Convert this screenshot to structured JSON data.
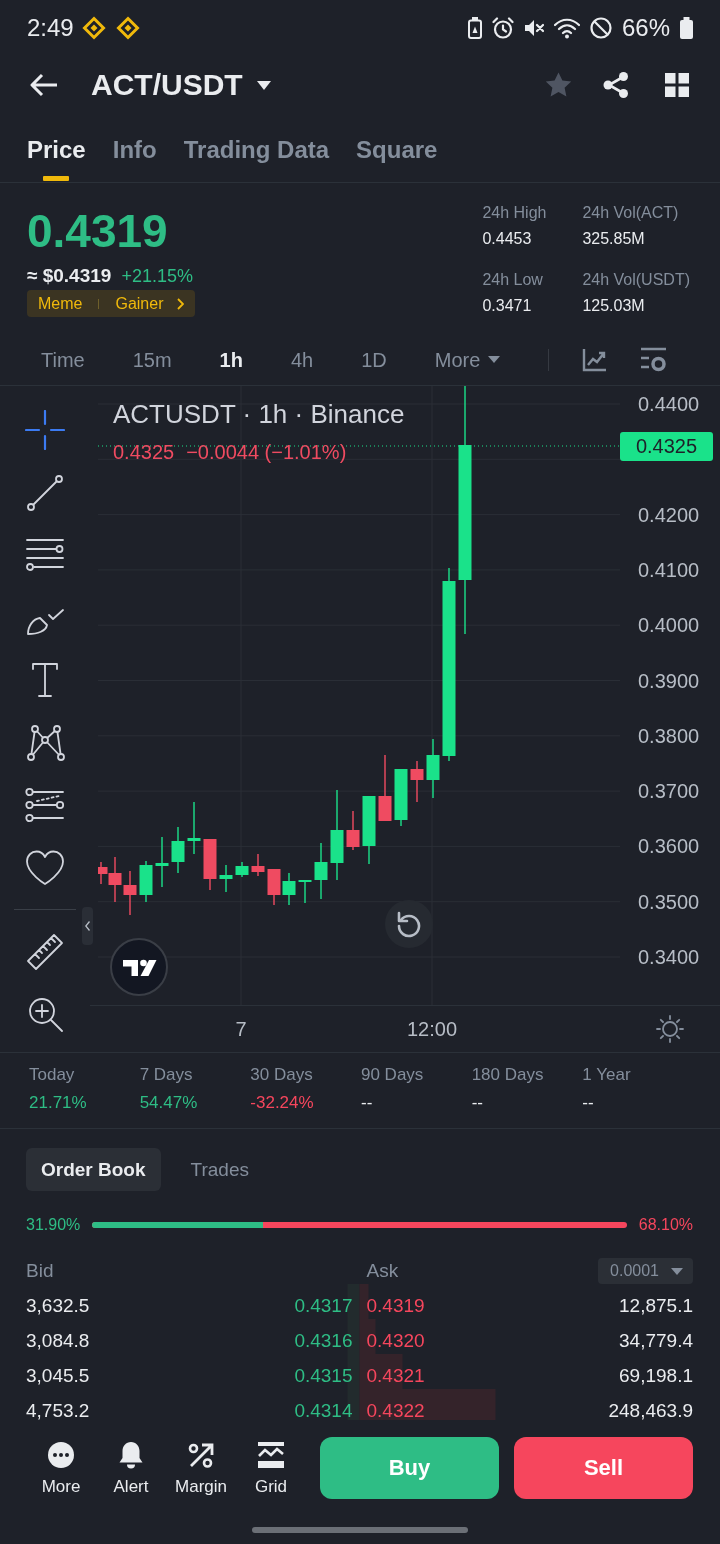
{
  "status_bar": {
    "time": "2:49",
    "battery": "66%"
  },
  "header": {
    "pair": "ACT/USDT",
    "favorited": false
  },
  "tabs": [
    {
      "label": "Price",
      "selected": true
    },
    {
      "label": "Info",
      "selected": false
    },
    {
      "label": "Trading Data",
      "selected": false
    },
    {
      "label": "Square",
      "selected": false
    }
  ],
  "ticker": {
    "price": "0.4319",
    "fiat_price": "≈ $0.4319",
    "change": "+21.15%",
    "tags": [
      "Meme",
      "Gainer"
    ],
    "stats": [
      {
        "label": "24h High",
        "value": "0.4453"
      },
      {
        "label": "24h Vol(ACT)",
        "value": "325.85M"
      },
      {
        "label": "24h Low",
        "value": "0.3471"
      },
      {
        "label": "24h Vol(USDT)",
        "value": "125.03M"
      }
    ]
  },
  "intervals": [
    {
      "label": "Time",
      "selected": false
    },
    {
      "label": "15m",
      "selected": false
    },
    {
      "label": "1h",
      "selected": true
    },
    {
      "label": "4h",
      "selected": false
    },
    {
      "label": "1D",
      "selected": false
    },
    {
      "label": "More",
      "selected": false
    }
  ],
  "drawing_tools": [
    {
      "kind": "crosshair",
      "selected": true
    },
    {
      "kind": "line",
      "selected": false
    },
    {
      "kind": "lines",
      "selected": false
    },
    {
      "kind": "brush",
      "selected": false
    },
    {
      "kind": "text",
      "selected": false
    },
    {
      "kind": "pattern",
      "selected": false
    },
    {
      "kind": "fib",
      "selected": false
    },
    {
      "kind": "heart",
      "selected": false
    }
  ],
  "measure_tools": [
    {
      "kind": "ruler",
      "selected": false
    },
    {
      "kind": "zoom",
      "selected": false
    }
  ],
  "chart": {
    "title": "ACTUSDT · 1h · Binance",
    "close": "0.4325",
    "change": "−0.0044 (−1.01%)",
    "last_price": "0.4325",
    "price_labels": [
      "0.4400",
      "0.4200",
      "0.4100",
      "0.4000",
      "0.3900",
      "0.3800",
      "0.3700",
      "0.3600",
      "0.3500",
      "0.3400"
    ],
    "time_labels": [
      "7",
      "12:00"
    ]
  },
  "periods": [
    {
      "label": "Today",
      "value": "21.71%",
      "color": "#2ebd85"
    },
    {
      "label": "7 Days",
      "value": "54.47%",
      "color": "#2ebd85"
    },
    {
      "label": "30 Days",
      "value": "-32.24%",
      "color": "#f6465d"
    },
    {
      "label": "90 Days",
      "value": "--",
      "color": "#eaecef"
    },
    {
      "label": "180 Days",
      "value": "--",
      "color": "#eaecef"
    },
    {
      "label": "1 Year",
      "value": "--",
      "color": "#eaecef"
    }
  ],
  "order_book": {
    "tabs": [
      {
        "label": "Order Book",
        "selected": true
      },
      {
        "label": "Trades",
        "selected": false
      }
    ],
    "buy_share": "31.90%",
    "sell_share": "68.10%",
    "ratio": {
      "level": 0.319
    },
    "bid_header": "Bid",
    "ask_header": "Ask",
    "precision": "0.0001",
    "rows": [
      {
        "bid": {
          "amount": "3,632.5",
          "price": "0.4317"
        },
        "ask": {
          "price": "0.4319",
          "amount": "12,875.1"
        }
      },
      {
        "bid": {
          "amount": "3,084.8",
          "price": "0.4316"
        },
        "ask": {
          "price": "0.4320",
          "amount": "34,779.4"
        }
      },
      {
        "bid": {
          "amount": "3,045.5",
          "price": "0.4315"
        },
        "ask": {
          "price": "0.4321",
          "amount": "69,198.1"
        }
      },
      {
        "bid": {
          "amount": "4,753.2",
          "price": "0.4314"
        },
        "ask": {
          "price": "0.4322",
          "amount": "248,463.9"
        }
      }
    ]
  },
  "actions": {
    "shortcuts": [
      {
        "kind": "more",
        "label": "More"
      },
      {
        "kind": "alert",
        "label": "Alert"
      },
      {
        "kind": "margin",
        "label": "Margin"
      },
      {
        "kind": "grid",
        "label": "Grid"
      }
    ],
    "buy": "Buy",
    "sell": "Sell"
  }
}
